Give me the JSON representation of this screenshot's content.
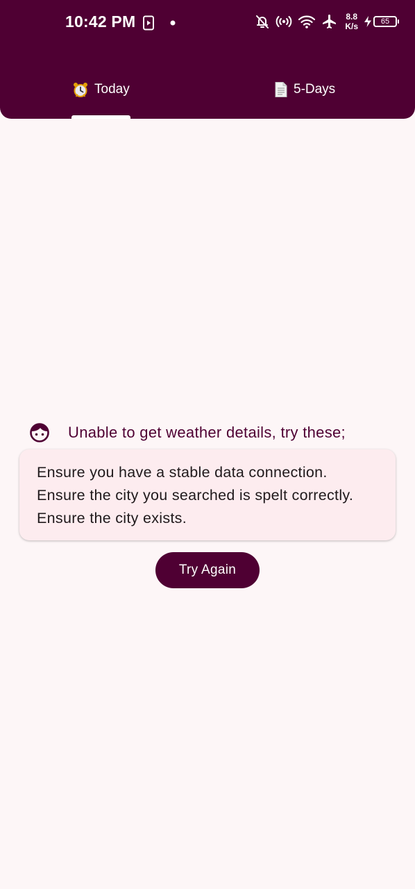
{
  "status_bar": {
    "time": "10:42 PM",
    "net_speed_value": "8.8",
    "net_speed_unit": "K/s",
    "battery_level": "65",
    "icons": [
      "screen-record-icon",
      "notification-dot-icon",
      "bell-off-icon",
      "hotspot-icon",
      "wifi-icon",
      "airplane-icon",
      "charging-icon",
      "battery-icon"
    ]
  },
  "tabs": [
    {
      "label": "Today",
      "icon": "alarm-clock-icon",
      "selected": true
    },
    {
      "label": "5-Days",
      "icon": "page-icon",
      "selected": false
    }
  ],
  "error": {
    "icon": "face-icon",
    "heading": "Unable to get weather details, try these;",
    "tips": [
      "Ensure you have a stable data connection.",
      "Ensure the city you searched is spelt correctly.",
      "Ensure the city exists."
    ]
  },
  "actions": {
    "try_again_label": "Try Again"
  },
  "colors": {
    "primary": "#4f0033",
    "background": "#fdf6f7",
    "card": "#fdecef",
    "text": "#201a1c"
  }
}
